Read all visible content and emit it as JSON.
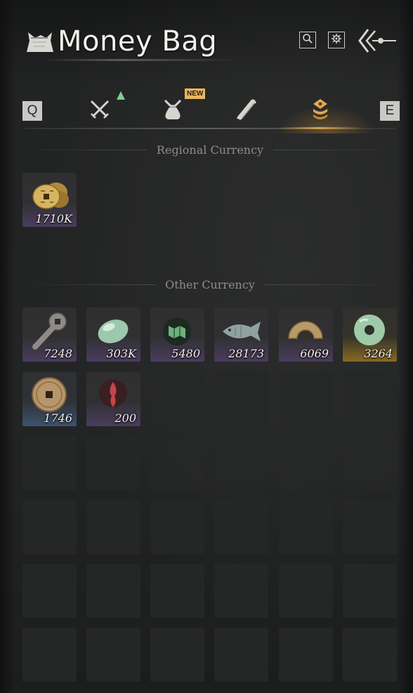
{
  "header": {
    "title": "Money Bag",
    "icons": {
      "bag": "money-bag-icon",
      "search": "search-icon",
      "settings": "gear-icon",
      "back": "back-arrow-icon"
    }
  },
  "tabs": {
    "prev_key": "Q",
    "next_key": "E",
    "items": [
      {
        "icon": "crossed-swords-icon",
        "active": false,
        "indicator": "up-arrow"
      },
      {
        "icon": "pouch-icon",
        "active": false,
        "badge": "NEW"
      },
      {
        "icon": "scroll-icon",
        "active": false
      },
      {
        "icon": "coins-icon",
        "active": true
      }
    ],
    "accent_color": "#e0aa50"
  },
  "regional": {
    "heading": "Regional Currency",
    "items": [
      {
        "name": "copper-coins-icon",
        "qty": "1710K",
        "rarity": "purple"
      }
    ]
  },
  "other": {
    "heading": "Other Currency",
    "items": [
      {
        "name": "key-coin-icon",
        "qty": "7248",
        "rarity": "purple"
      },
      {
        "name": "jade-stone-icon",
        "qty": "303K",
        "rarity": "purple"
      },
      {
        "name": "map-token-icon",
        "qty": "5480",
        "rarity": "purple"
      },
      {
        "name": "fish-icon",
        "qty": "28173",
        "rarity": "purple"
      },
      {
        "name": "half-coin-icon",
        "qty": "6069",
        "rarity": "purple"
      },
      {
        "name": "jade-ring-icon",
        "qty": "3264",
        "rarity": "gold"
      },
      {
        "name": "bronze-coin-icon",
        "qty": "1746",
        "rarity": "blue"
      },
      {
        "name": "spirit-flame-icon",
        "qty": "200",
        "rarity": "purple"
      }
    ],
    "total_slots": 36
  }
}
